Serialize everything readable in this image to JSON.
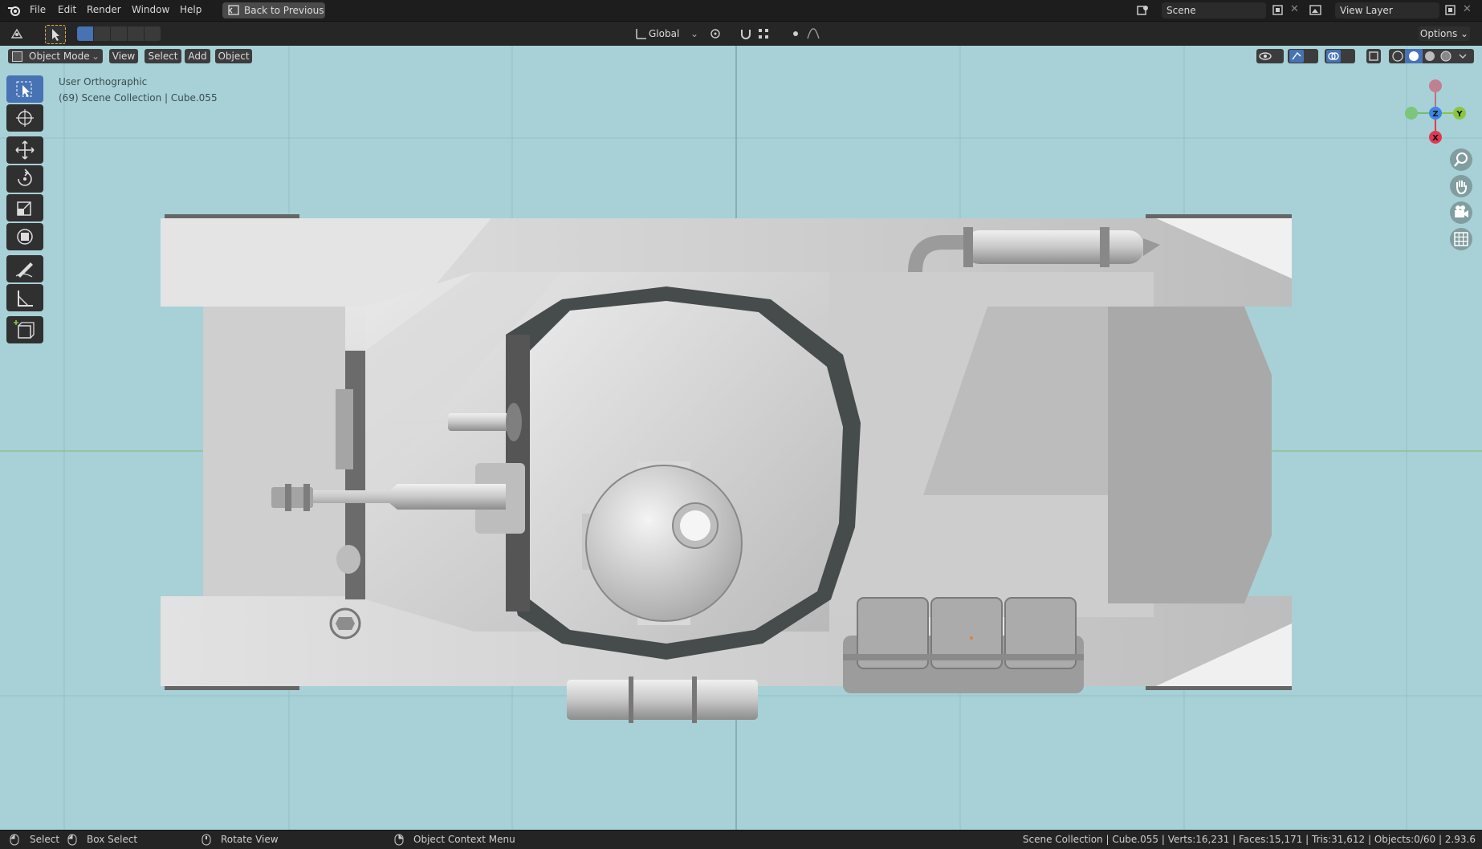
{
  "app": {
    "name": "Blender"
  },
  "menu": {
    "file": "File",
    "edit": "Edit",
    "render": "Render",
    "window": "Window",
    "help": "Help"
  },
  "back_button": "Back to Previous",
  "scene": {
    "label": "Scene"
  },
  "view_layer": {
    "label": "View Layer"
  },
  "toolbar": {
    "transform_orientation": "Global",
    "options": "Options"
  },
  "viewport_header": {
    "mode": "Object Mode",
    "view": "View",
    "select": "Select",
    "add": "Add",
    "object": "Object"
  },
  "viewport_info": {
    "projection": "User Orthographic",
    "collection": "(69) Scene Collection | Cube.055"
  },
  "gizmo": {
    "z": "Z",
    "y": "Y",
    "x": "X",
    "colors": {
      "x": "#e03a52",
      "y": "#8bc63f",
      "z": "#3d86e6"
    }
  },
  "status": {
    "select": "Select",
    "box_select": "Box Select",
    "rotate_view": "Rotate View",
    "context_menu": "Object Context Menu",
    "stats": "Scene Collection | Cube.055 | Verts:16,231 | Faces:15,171 | Tris:31,612 | Objects:0/60 | 2.93.6"
  }
}
